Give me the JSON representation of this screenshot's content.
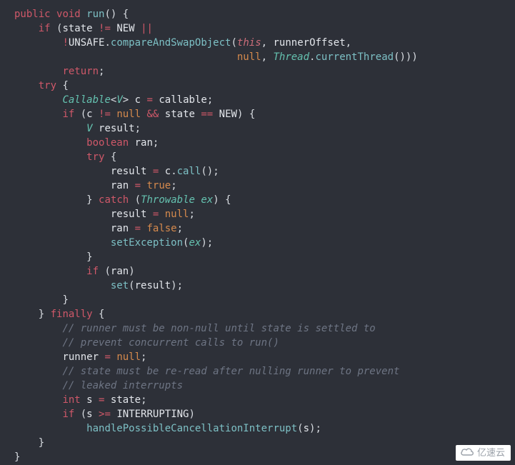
{
  "watermark": {
    "text": "亿速云",
    "icon_label": "cloud-logo"
  },
  "code": {
    "l01": {
      "kw1": "public",
      "kw2": "void",
      "fn": "run",
      "p1": "()",
      "p2": " {"
    },
    "l02": {
      "kw": "if",
      "p1": " (",
      "id1": "state",
      "sp1": " ",
      "op1": "!=",
      "sp2": " ",
      "id2": "NEW",
      "sp3": " ",
      "op2": "||"
    },
    "l03": {
      "op1": "!",
      "id1": "UNSAFE",
      "p1": ".",
      "fn": "compareAndSwapObject",
      "p2": "(",
      "this": "this",
      "c1": ",",
      "sp1": " ",
      "id2": "runnerOffset",
      "c2": ","
    },
    "l04": {
      "nul": "null",
      "c1": ",",
      "sp1": " ",
      "ty": "Thread",
      "p1": ".",
      "fn": "currentThread",
      "p2": "()))"
    },
    "l05": {
      "kw": "return",
      "p1": ";"
    },
    "l06": {
      "kw": "try",
      "p1": " {"
    },
    "l07": {
      "ty1": "Callable",
      "p1": "<",
      "ty2": "V",
      "p2": ">",
      "sp1": " ",
      "id1": "c",
      "sp2": " ",
      "op": "=",
      "sp3": " ",
      "id2": "callable",
      "p3": ";"
    },
    "l08": {
      "kw": "if",
      "p1": " (",
      "id1": "c",
      "sp1": " ",
      "op1": "!=",
      "sp2": " ",
      "nul": "null",
      "sp3": " ",
      "op2": "&&",
      "sp4": " ",
      "id2": "state",
      "sp5": " ",
      "op3": "==",
      "sp6": " ",
      "id3": "NEW",
      "p2": ") {"
    },
    "l09": {
      "ty": "V",
      "sp1": " ",
      "id": "result",
      "p1": ";"
    },
    "l10": {
      "kw": "boolean",
      "sp1": " ",
      "id": "ran",
      "p1": ";"
    },
    "l11": {
      "kw": "try",
      "p1": " {"
    },
    "l12": {
      "id1": "result",
      "sp1": " ",
      "op": "=",
      "sp2": " ",
      "id2": "c",
      "p1": ".",
      "fn": "call",
      "p2": "();"
    },
    "l13": {
      "id": "ran",
      "sp1": " ",
      "op": "=",
      "sp2": " ",
      "val": "true",
      "p1": ";"
    },
    "l14": {
      "p1": "}",
      "sp1": " ",
      "kw": "catch",
      "sp2": " ",
      "p2": "(",
      "ty": "Throwable",
      "sp3": " ",
      "ex": "ex",
      "p3": ") {"
    },
    "l15": {
      "id": "result",
      "sp1": " ",
      "op": "=",
      "sp2": " ",
      "nul": "null",
      "p1": ";"
    },
    "l16": {
      "id": "ran",
      "sp1": " ",
      "op": "=",
      "sp2": " ",
      "val": "false",
      "p1": ";"
    },
    "l17": {
      "fn": "setException",
      "p1": "(",
      "ex": "ex",
      "p2": ");"
    },
    "l18": {
      "p1": "}"
    },
    "l19": {
      "kw": "if",
      "sp1": " ",
      "p1": "(",
      "id": "ran",
      "p2": ")"
    },
    "l20": {
      "fn": "set",
      "p1": "(",
      "id": "result",
      "p2": ");"
    },
    "l21": {
      "p1": "}"
    },
    "l22": {
      "p1": "}",
      "sp1": " ",
      "kw": "finally",
      "sp2": " ",
      "p2": "{"
    },
    "l23": {
      "cmt": "// runner must be non-null until state is settled to"
    },
    "l24": {
      "cmt": "// prevent concurrent calls to run()"
    },
    "l25": {
      "id": "runner",
      "sp1": " ",
      "op": "=",
      "sp2": " ",
      "nul": "null",
      "p1": ";"
    },
    "l26": {
      "cmt": "// state must be re-read after nulling runner to prevent"
    },
    "l27": {
      "cmt": "// leaked interrupts"
    },
    "l28": {
      "kw": "int",
      "sp1": " ",
      "id1": "s",
      "sp2": " ",
      "op": "=",
      "sp3": " ",
      "id2": "state",
      "p1": ";"
    },
    "l29": {
      "kw": "if",
      "sp1": " ",
      "p1": "(",
      "id1": "s",
      "sp2": " ",
      "op": ">=",
      "sp3": " ",
      "id2": "INTERRUPTING",
      "p2": ")"
    },
    "l30": {
      "fn": "handlePossibleCancellationInterrupt",
      "p1": "(",
      "id": "s",
      "p2": ");"
    },
    "l31": {
      "p1": "}"
    },
    "l32": {
      "p1": "}"
    }
  }
}
